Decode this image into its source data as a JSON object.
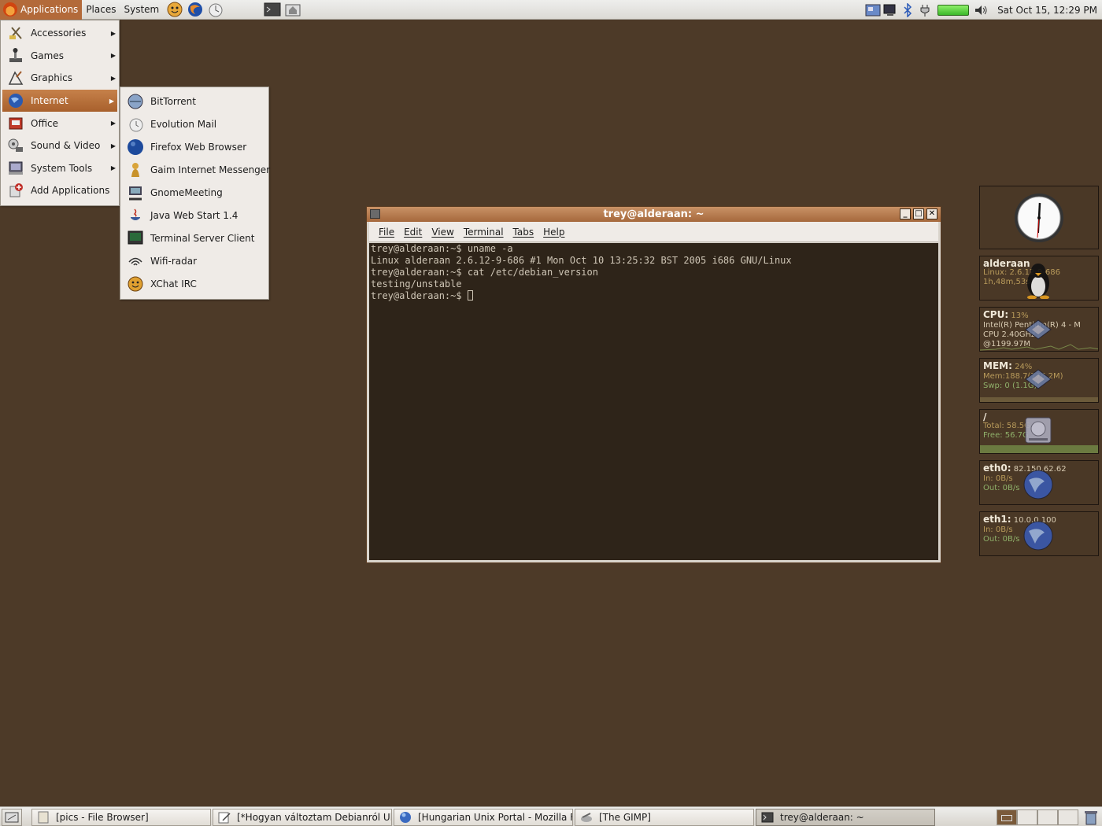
{
  "top_panel": {
    "applications_label": "Applications",
    "places_label": "Places",
    "system_label": "System",
    "launchers": [
      "gaim-icon",
      "firefox-icon",
      "evolution-icon",
      "terminal-launcher-icon",
      "home-folder-icon"
    ],
    "clock": "Sat Oct 15, 12:29 PM"
  },
  "main_menu": {
    "items": [
      {
        "label": "Accessories",
        "icon": "accessories-icon",
        "submenu": true
      },
      {
        "label": "Games",
        "icon": "games-icon",
        "submenu": true
      },
      {
        "label": "Graphics",
        "icon": "graphics-icon",
        "submenu": true
      },
      {
        "label": "Internet",
        "icon": "internet-icon",
        "submenu": true,
        "active": true
      },
      {
        "label": "Office",
        "icon": "office-icon",
        "submenu": true
      },
      {
        "label": "Sound & Video",
        "icon": "sound-video-icon",
        "submenu": true
      },
      {
        "label": "System Tools",
        "icon": "system-tools-icon",
        "submenu": true
      },
      {
        "label": "Add Applications",
        "icon": "add-applications-icon",
        "submenu": false
      }
    ]
  },
  "internet_menu": {
    "items": [
      {
        "label": "BitTorrent",
        "icon": "bittorrent-icon"
      },
      {
        "label": "Evolution Mail",
        "icon": "evolution-mail-icon"
      },
      {
        "label": "Firefox Web Browser",
        "icon": "firefox-icon"
      },
      {
        "label": "Gaim Internet Messenger",
        "icon": "gaim-icon"
      },
      {
        "label": "GnomeMeeting",
        "icon": "gnomemeeting-icon"
      },
      {
        "label": "Java Web Start 1.4",
        "icon": "java-icon"
      },
      {
        "label": "Terminal Server Client",
        "icon": "terminal-server-icon"
      },
      {
        "label": "Wifi-radar",
        "icon": "wifi-icon"
      },
      {
        "label": "XChat IRC",
        "icon": "xchat-icon"
      }
    ]
  },
  "terminal": {
    "title": "trey@alderaan: ~",
    "menu": [
      "File",
      "Edit",
      "View",
      "Terminal",
      "Tabs",
      "Help"
    ],
    "lines": [
      "trey@alderaan:~$ uname -a",
      "Linux alderaan 2.6.12-9-686 #1 Mon Oct 10 13:25:32 BST 2005 i686 GNU/Linux",
      "trey@alderaan:~$ cat /etc/debian_version",
      "testing/unstable",
      "trey@alderaan:~$ "
    ]
  },
  "widgets": {
    "host": {
      "name": "alderaan",
      "line1": "Linux: 2.6.12-9-686",
      "line2": "1h,48m,53s"
    },
    "cpu": {
      "label": "CPU:",
      "value": "13%",
      "line1": "Intel(R) Pentium(R) 4 - M",
      "line2": "CPU 2.40GHz",
      "line3": "@1199.97M"
    },
    "mem": {
      "label": "MEM:",
      "value": "24%",
      "line1": "Mem:188.7(776.2M)",
      "line2": "Swp: 0 (1.1G)"
    },
    "disk": {
      "label": "/",
      "line1": "Total: 58.5G",
      "line2": "Free: 56.7G"
    },
    "eth0": {
      "label": "eth0:",
      "ip": "82.150.62.62",
      "in": "In:    0B/s",
      "out": "Out:  0B/s"
    },
    "eth1": {
      "label": "eth1:",
      "ip": "10.0.0.100",
      "in": "In:    0B/s",
      "out": "Out:  0B/s"
    }
  },
  "taskbar": {
    "tasks": [
      {
        "label": "[pics - File Browser]",
        "icon": "folder-icon"
      },
      {
        "label": "[*Hogyan változtam Debianról Ub...",
        "icon": "text-editor-icon"
      },
      {
        "label": "[Hungarian Unix Portal - Mozilla Fi...",
        "icon": "firefox-icon"
      },
      {
        "label": "[The GIMP]",
        "icon": "gimp-icon"
      },
      {
        "label": "trey@alderaan: ~",
        "icon": "terminal-icon",
        "active": true
      }
    ],
    "workspaces": 4,
    "active_workspace": 1
  },
  "colors": {
    "desktop": "#4d3a28",
    "accent": "#b36a3a",
    "terminal_bg": "#2e2419"
  }
}
